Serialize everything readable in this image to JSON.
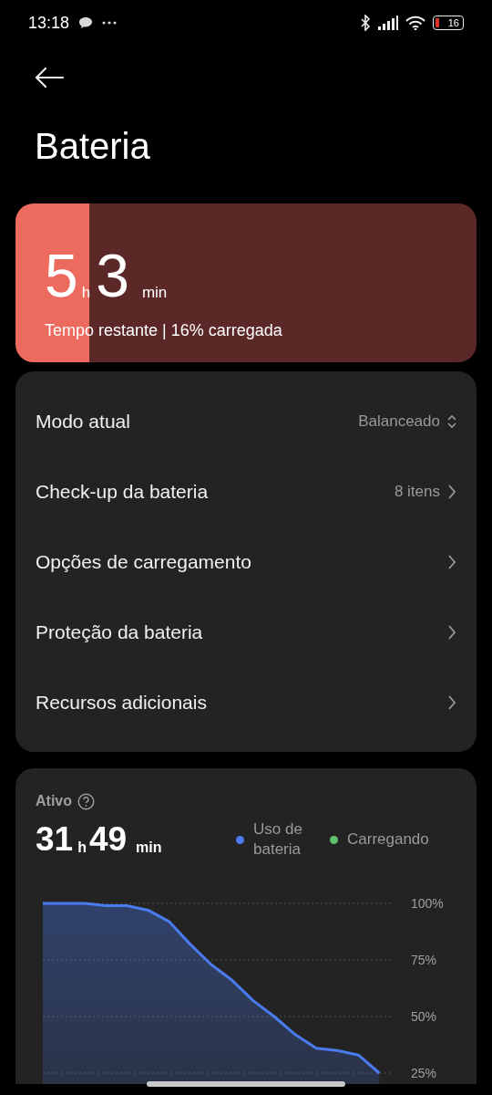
{
  "status_bar": {
    "time": "13:18",
    "battery": "16"
  },
  "title": "Bateria",
  "remaining": {
    "hours": "5",
    "hours_unit": "h",
    "minutes": "3",
    "minutes_unit": "min",
    "caption": "Tempo restante | 16% carregada",
    "level": 0.16
  },
  "settings": [
    {
      "label": "Modo atual",
      "value": "Balanceado",
      "kind": "dropdown"
    },
    {
      "label": "Check-up da bateria",
      "value": "8 itens",
      "kind": "link"
    },
    {
      "label": "Opções de carregamento",
      "kind": "link"
    },
    {
      "label": "Proteção da bateria",
      "kind": "link"
    },
    {
      "label": "Recursos adicionais",
      "kind": "link"
    }
  ],
  "usage": {
    "label": "Ativo",
    "hours": "31",
    "hours_unit": "h",
    "minutes": "49",
    "minutes_unit": "min",
    "legend": [
      {
        "label": "Carregando",
        "color": "#5ec26a"
      }
    ],
    "chart_data": {
      "type": "area",
      "grid": true,
      "ylim": [
        25,
        100
      ],
      "categories": [
        null,
        null,
        null,
        null,
        null,
        null,
        null,
        null,
        null,
        null,
        null,
        null,
        null,
        null,
        null,
        null,
        null
      ],
      "series": [
        {
          "name": "Uso de bateria",
          "color": "#4a7cf0",
          "values": [
            100,
            100,
            100,
            99,
            99,
            97,
            92,
            82,
            73,
            66,
            57,
            50,
            42,
            36,
            35,
            33,
            25
          ]
        }
      ],
      "yticks": [
        {
          "value": 100,
          "label": "100%"
        },
        {
          "value": 75,
          "label": "75%"
        },
        {
          "value": 50,
          "label": "50%"
        },
        {
          "value": 25,
          "label": "25%"
        }
      ]
    }
  }
}
